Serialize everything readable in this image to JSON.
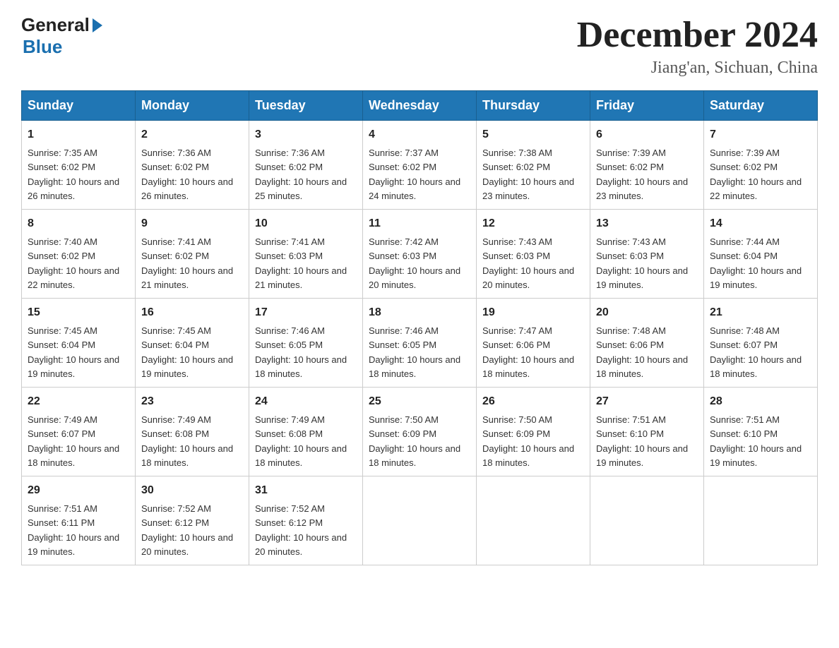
{
  "header": {
    "logo": {
      "general": "General",
      "blue": "Blue"
    },
    "title": "December 2024",
    "location": "Jiang'an, Sichuan, China"
  },
  "days_of_week": [
    "Sunday",
    "Monday",
    "Tuesday",
    "Wednesday",
    "Thursday",
    "Friday",
    "Saturday"
  ],
  "weeks": [
    [
      {
        "day": "1",
        "sunrise": "7:35 AM",
        "sunset": "6:02 PM",
        "daylight": "10 hours and 26 minutes."
      },
      {
        "day": "2",
        "sunrise": "7:36 AM",
        "sunset": "6:02 PM",
        "daylight": "10 hours and 26 minutes."
      },
      {
        "day": "3",
        "sunrise": "7:36 AM",
        "sunset": "6:02 PM",
        "daylight": "10 hours and 25 minutes."
      },
      {
        "day": "4",
        "sunrise": "7:37 AM",
        "sunset": "6:02 PM",
        "daylight": "10 hours and 24 minutes."
      },
      {
        "day": "5",
        "sunrise": "7:38 AM",
        "sunset": "6:02 PM",
        "daylight": "10 hours and 23 minutes."
      },
      {
        "day": "6",
        "sunrise": "7:39 AM",
        "sunset": "6:02 PM",
        "daylight": "10 hours and 23 minutes."
      },
      {
        "day": "7",
        "sunrise": "7:39 AM",
        "sunset": "6:02 PM",
        "daylight": "10 hours and 22 minutes."
      }
    ],
    [
      {
        "day": "8",
        "sunrise": "7:40 AM",
        "sunset": "6:02 PM",
        "daylight": "10 hours and 22 minutes."
      },
      {
        "day": "9",
        "sunrise": "7:41 AM",
        "sunset": "6:02 PM",
        "daylight": "10 hours and 21 minutes."
      },
      {
        "day": "10",
        "sunrise": "7:41 AM",
        "sunset": "6:03 PM",
        "daylight": "10 hours and 21 minutes."
      },
      {
        "day": "11",
        "sunrise": "7:42 AM",
        "sunset": "6:03 PM",
        "daylight": "10 hours and 20 minutes."
      },
      {
        "day": "12",
        "sunrise": "7:43 AM",
        "sunset": "6:03 PM",
        "daylight": "10 hours and 20 minutes."
      },
      {
        "day": "13",
        "sunrise": "7:43 AM",
        "sunset": "6:03 PM",
        "daylight": "10 hours and 19 minutes."
      },
      {
        "day": "14",
        "sunrise": "7:44 AM",
        "sunset": "6:04 PM",
        "daylight": "10 hours and 19 minutes."
      }
    ],
    [
      {
        "day": "15",
        "sunrise": "7:45 AM",
        "sunset": "6:04 PM",
        "daylight": "10 hours and 19 minutes."
      },
      {
        "day": "16",
        "sunrise": "7:45 AM",
        "sunset": "6:04 PM",
        "daylight": "10 hours and 19 minutes."
      },
      {
        "day": "17",
        "sunrise": "7:46 AM",
        "sunset": "6:05 PM",
        "daylight": "10 hours and 18 minutes."
      },
      {
        "day": "18",
        "sunrise": "7:46 AM",
        "sunset": "6:05 PM",
        "daylight": "10 hours and 18 minutes."
      },
      {
        "day": "19",
        "sunrise": "7:47 AM",
        "sunset": "6:06 PM",
        "daylight": "10 hours and 18 minutes."
      },
      {
        "day": "20",
        "sunrise": "7:48 AM",
        "sunset": "6:06 PM",
        "daylight": "10 hours and 18 minutes."
      },
      {
        "day": "21",
        "sunrise": "7:48 AM",
        "sunset": "6:07 PM",
        "daylight": "10 hours and 18 minutes."
      }
    ],
    [
      {
        "day": "22",
        "sunrise": "7:49 AM",
        "sunset": "6:07 PM",
        "daylight": "10 hours and 18 minutes."
      },
      {
        "day": "23",
        "sunrise": "7:49 AM",
        "sunset": "6:08 PM",
        "daylight": "10 hours and 18 minutes."
      },
      {
        "day": "24",
        "sunrise": "7:49 AM",
        "sunset": "6:08 PM",
        "daylight": "10 hours and 18 minutes."
      },
      {
        "day": "25",
        "sunrise": "7:50 AM",
        "sunset": "6:09 PM",
        "daylight": "10 hours and 18 minutes."
      },
      {
        "day": "26",
        "sunrise": "7:50 AM",
        "sunset": "6:09 PM",
        "daylight": "10 hours and 18 minutes."
      },
      {
        "day": "27",
        "sunrise": "7:51 AM",
        "sunset": "6:10 PM",
        "daylight": "10 hours and 19 minutes."
      },
      {
        "day": "28",
        "sunrise": "7:51 AM",
        "sunset": "6:10 PM",
        "daylight": "10 hours and 19 minutes."
      }
    ],
    [
      {
        "day": "29",
        "sunrise": "7:51 AM",
        "sunset": "6:11 PM",
        "daylight": "10 hours and 19 minutes."
      },
      {
        "day": "30",
        "sunrise": "7:52 AM",
        "sunset": "6:12 PM",
        "daylight": "10 hours and 20 minutes."
      },
      {
        "day": "31",
        "sunrise": "7:52 AM",
        "sunset": "6:12 PM",
        "daylight": "10 hours and 20 minutes."
      },
      null,
      null,
      null,
      null
    ]
  ]
}
